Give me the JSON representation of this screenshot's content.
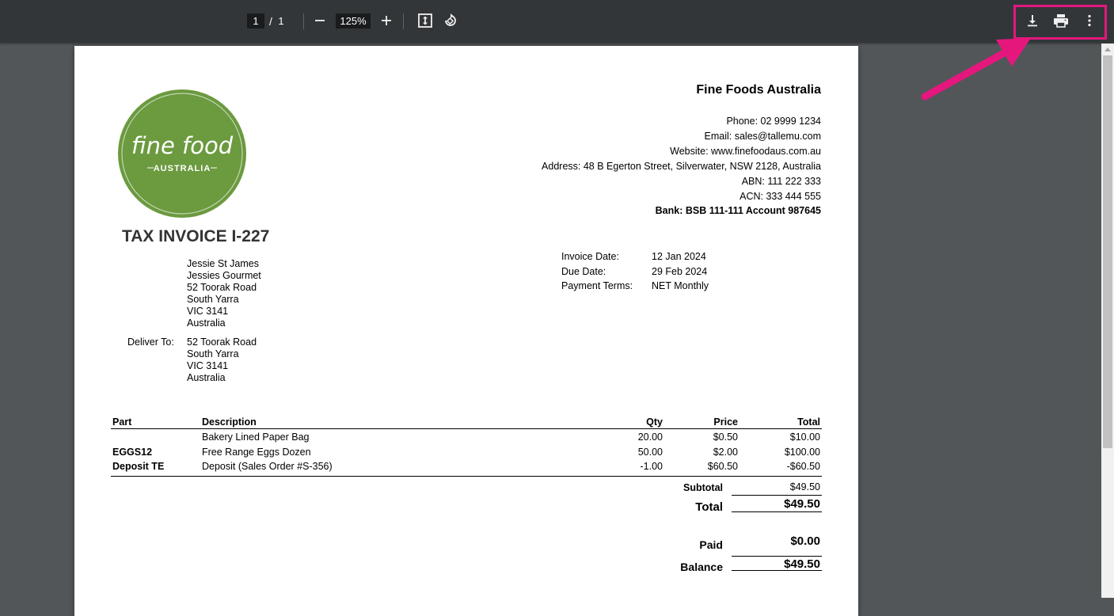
{
  "toolbar": {
    "page_current": "1",
    "page_separator": "/",
    "page_total": "1",
    "zoom_level": "125%",
    "icons": [
      "zoom-out-icon",
      "zoom-in-icon",
      "fit-page-icon",
      "rotate-icon",
      "download-icon",
      "print-icon",
      "more-vert-icon"
    ]
  },
  "colors": {
    "toolbar_bg": "#323639",
    "viewer_bg": "#525659",
    "highlight": "#e5177d",
    "logo_green": "#6b9a3f"
  },
  "invoice": {
    "logo": {
      "line1": "fine food",
      "line2": "AUSTRALIA"
    },
    "company_name": "Fine Foods Australia",
    "contact": {
      "phone": "Phone: 02 9999 1234",
      "email": "Email: sales@tallemu.com",
      "website": "Website: www.finefoodaus.com.au",
      "address": "Address: 48 B Egerton Street, Silverwater, NSW 2128, Australia",
      "abn": "ABN: 111 222 333",
      "acn": "ACN: 333 444 555",
      "bank": "Bank: BSB 111-111 Account 987645"
    },
    "title": "TAX INVOICE I-227",
    "bill_to": [
      "Jessie St James",
      "Jessies Gourmet",
      "52 Toorak Road",
      "South Yarra",
      "VIC 3141",
      "Australia"
    ],
    "deliver_label": "Deliver To:",
    "deliver_to": [
      "52 Toorak Road",
      "South Yarra",
      "VIC 3141",
      "Australia"
    ],
    "meta": [
      {
        "label": "Invoice Date:",
        "value": "12 Jan 2024"
      },
      {
        "label": "Due Date:",
        "value": "29 Feb 2024"
      },
      {
        "label": "Payment Terms:",
        "value": "NET Monthly"
      }
    ],
    "table": {
      "headers": {
        "part": "Part",
        "description": "Description",
        "qty": "Qty",
        "price": "Price",
        "total": "Total"
      },
      "rows": [
        {
          "part": "",
          "description": "Bakery Lined Paper Bag",
          "qty": "20.00",
          "price": "$0.50",
          "total": "$10.00"
        },
        {
          "part": "EGGS12",
          "description": "Free Range Eggs Dozen",
          "qty": "50.00",
          "price": "$2.00",
          "total": "$100.00"
        },
        {
          "part": "Deposit TE",
          "description": "Deposit (Sales Order #S-356)",
          "qty": "-1.00",
          "price": "$60.50",
          "total": "-$60.50"
        }
      ]
    },
    "totals": {
      "subtotal_label": "Subtotal",
      "subtotal_value": "$49.50",
      "total_label": "Total",
      "total_value": "$49.50",
      "paid_label": "Paid",
      "paid_value": "$0.00",
      "balance_label": "Balance",
      "balance_value": "$49.50"
    }
  }
}
